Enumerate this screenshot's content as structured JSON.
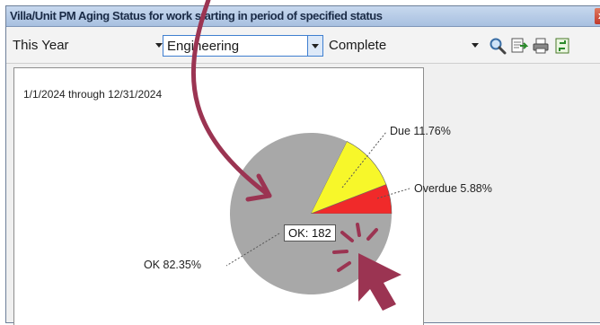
{
  "window": {
    "title": "Villa/Unit PM Aging Status for work starting in period of specified status",
    "close_label": "x"
  },
  "toolbar": {
    "period": "This Year",
    "department": "Engineering",
    "status": "Complete",
    "icons": [
      "search-icon",
      "report-icon",
      "print-icon",
      "export-icon"
    ]
  },
  "report": {
    "date_range": "1/1/2024 through 12/31/2024",
    "tooltip": "OK: 182"
  },
  "chart_data": {
    "type": "pie",
    "categories": [
      "OK",
      "Due",
      "Overdue"
    ],
    "values": [
      82.35,
      11.76,
      5.88
    ],
    "labels": [
      "OK 82.35%",
      "Due 11.76%",
      "Overdue 5.88%"
    ],
    "colors": [
      "#a8a8a8",
      "#f7f72a",
      "#f02a2a"
    ]
  },
  "annotation": {
    "arrow_color": "#9b3452"
  }
}
